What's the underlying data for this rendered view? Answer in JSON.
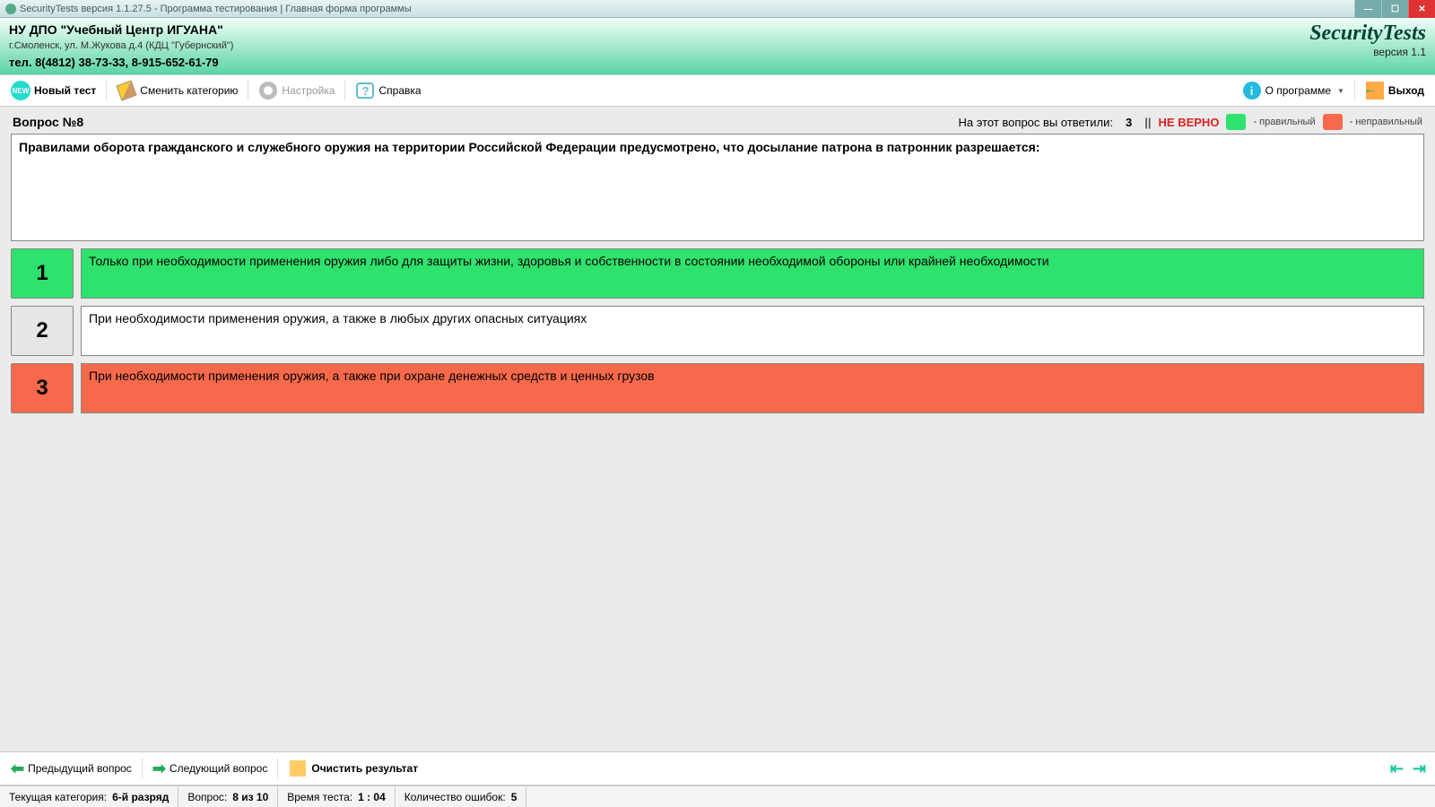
{
  "window": {
    "title": "SecurityTests версия 1.1.27.5 - Программа тестирования | Главная форма программы"
  },
  "header": {
    "org_name": "НУ ДПО \"Учебный Центр ИГУАНА\"",
    "org_addr": "г.Смоленск, ул. М.Жукова д.4 (КДЦ \"Губернский\")",
    "org_phone": "тел. 8(4812) 38-73-33, 8-915-652-61-79",
    "brand": "SecurityTests",
    "brand_version": "версия 1.1"
  },
  "toolbar": {
    "new_test": "Новый тест",
    "change_cat": "Сменить категорию",
    "settings": "Настройка",
    "help": "Справка",
    "about": "О программе",
    "exit": "Выход"
  },
  "question": {
    "label": "Вопрос №8",
    "answered_label": "На этот вопрос вы ответили:",
    "answered_count": "3",
    "result": "НЕ ВЕРНО",
    "legend_correct": "- правильный",
    "legend_wrong": "- неправильный",
    "text": "Правилами оборота гражданского и служебного оружия на территории Российской Федерации предусмотрено, что досылание патрона в патронник разрешается:",
    "answers": [
      {
        "num": "1",
        "text": "Только при необходимости применения оружия либо для защиты жизни, здоровья и собственности в состоянии необходимой обороны или крайней необходимости",
        "num_bg": "bg-green",
        "txt_bg": "bg-green"
      },
      {
        "num": "2",
        "text": "При необходимости применения оружия, а также в любых других опасных ситуациях",
        "num_bg": "bg-gray",
        "txt_bg": "bg-white"
      },
      {
        "num": "3",
        "text": "При необходимости применения оружия, а также при охране денежных средств и ценных грузов",
        "num_bg": "bg-red",
        "txt_bg": "bg-red"
      }
    ]
  },
  "bottom": {
    "prev": "Предыдущий вопрос",
    "next": "Следующий вопрос",
    "clear": "Очистить результат"
  },
  "status": {
    "cat_label": "Текущая категория:",
    "cat_value": "6-й разряд",
    "q_label": "Вопрос:",
    "q_value": "8 из 10",
    "time_label": "Время теста:",
    "time_value": "1 : 04",
    "err_label": "Количество ошибок:",
    "err_value": "5"
  }
}
